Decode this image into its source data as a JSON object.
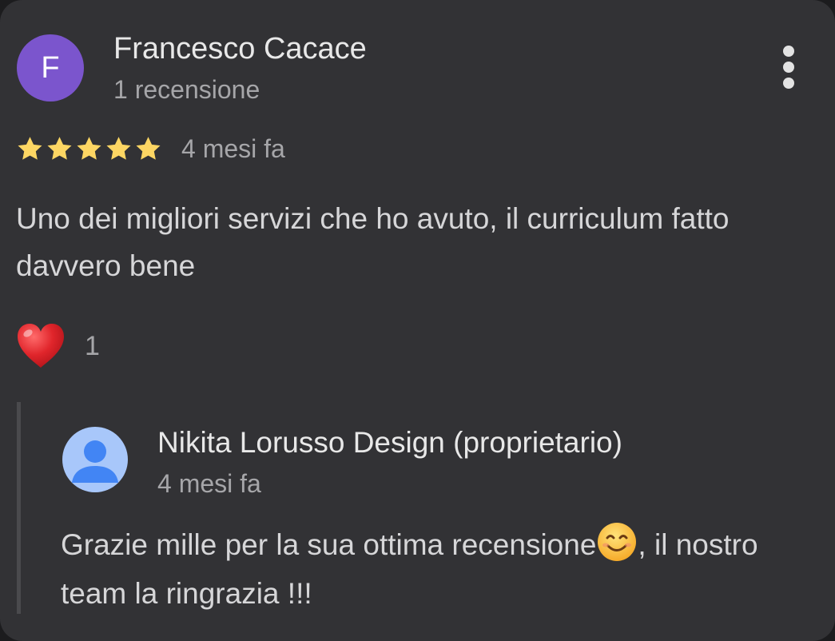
{
  "review": {
    "avatar_initial": "F",
    "reviewer_name": "Francesco Cacace",
    "review_count": "1 recensione",
    "rating": 5,
    "rating_max": 5,
    "date": "4 mesi fa",
    "text": "Uno dei migliori servizi che ho avuto, il curriculum fatto davvero bene",
    "reaction": {
      "icon": "heart-icon",
      "count": "1"
    }
  },
  "reply": {
    "owner_name": "Nikita Lorusso Design (proprietario)",
    "date": "4 mesi fa",
    "text_before_emoji": "Grazie mille per la sua ottima recensione",
    "emoji": "smiling-face-icon",
    "text_after_emoji": ", il nostro team la ringrazia !!!"
  },
  "colors": {
    "card_background": "#323235",
    "avatar_purple": "#7b55cd",
    "owner_avatar_blue": "#a8c7fa",
    "owner_avatar_figure": "#4285f4",
    "star_yellow": "#fdd663",
    "heart_red": "#e0252b"
  }
}
